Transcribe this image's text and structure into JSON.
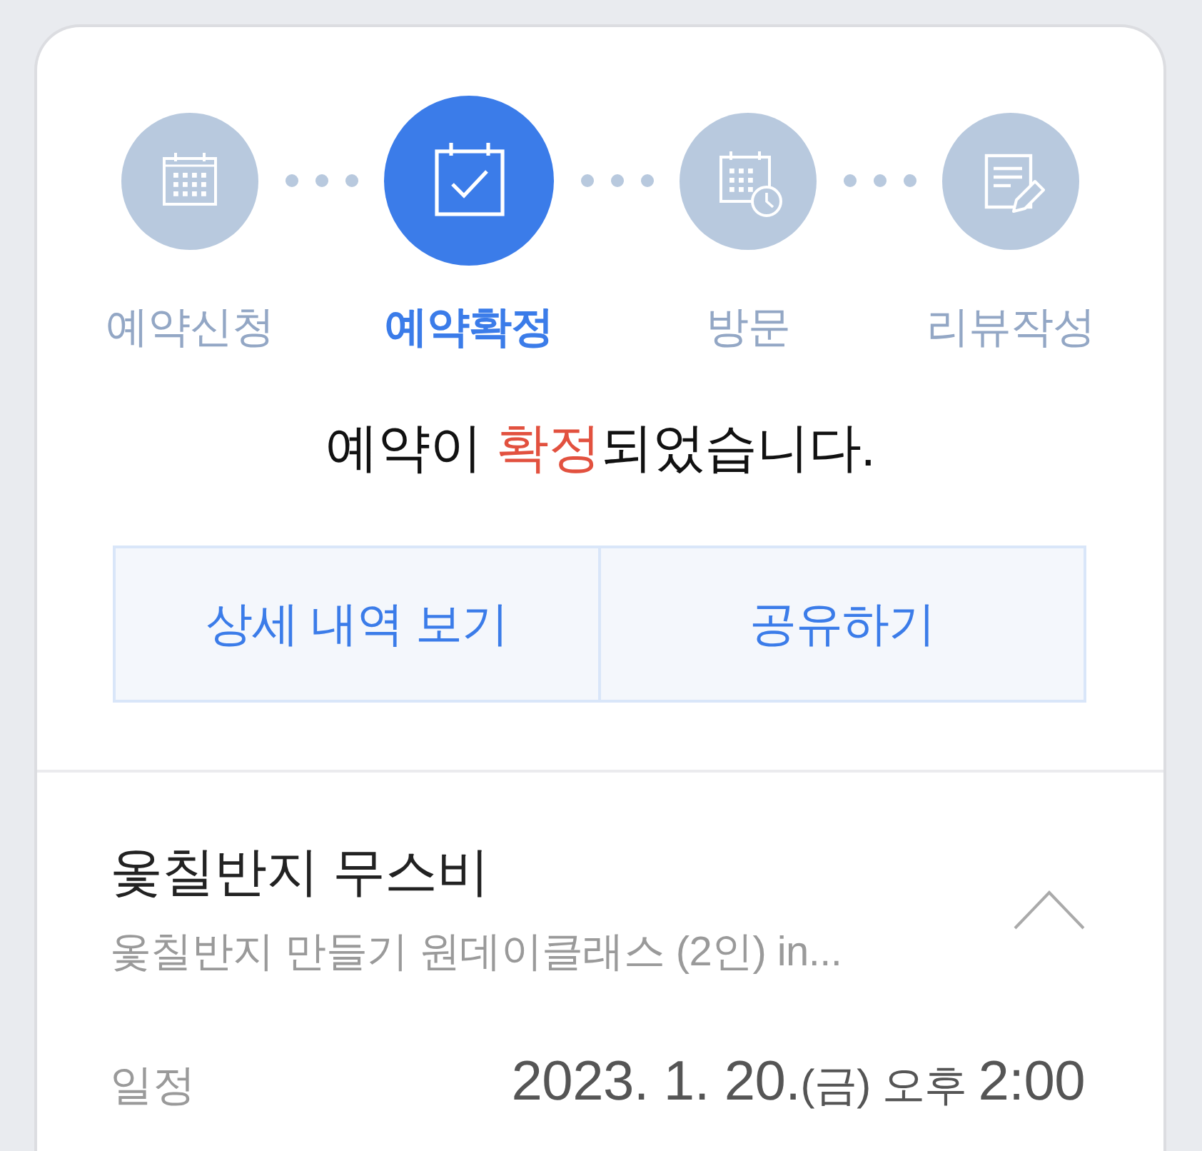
{
  "progress": {
    "steps": [
      {
        "label": "예약신청",
        "selected": false
      },
      {
        "label": "예약확정",
        "selected": true
      },
      {
        "label": "방문",
        "selected": false
      },
      {
        "label": "리뷰작성",
        "selected": false
      }
    ]
  },
  "message": {
    "before": "예약이 ",
    "highlight": "확정",
    "after": "되었습니다."
  },
  "buttons": [
    "상세 내역 보기",
    "공유하기"
  ],
  "booking": {
    "title": "옻칠반지 무스비",
    "subtitle": "옻칠반지 만들기 원데이클래스 (2인) in...",
    "expanded": true,
    "schedule": {
      "label": "일정",
      "date": "2023. 1. 20.",
      "weekday": "(금)",
      "period": "오후",
      "time": "2:00"
    }
  }
}
